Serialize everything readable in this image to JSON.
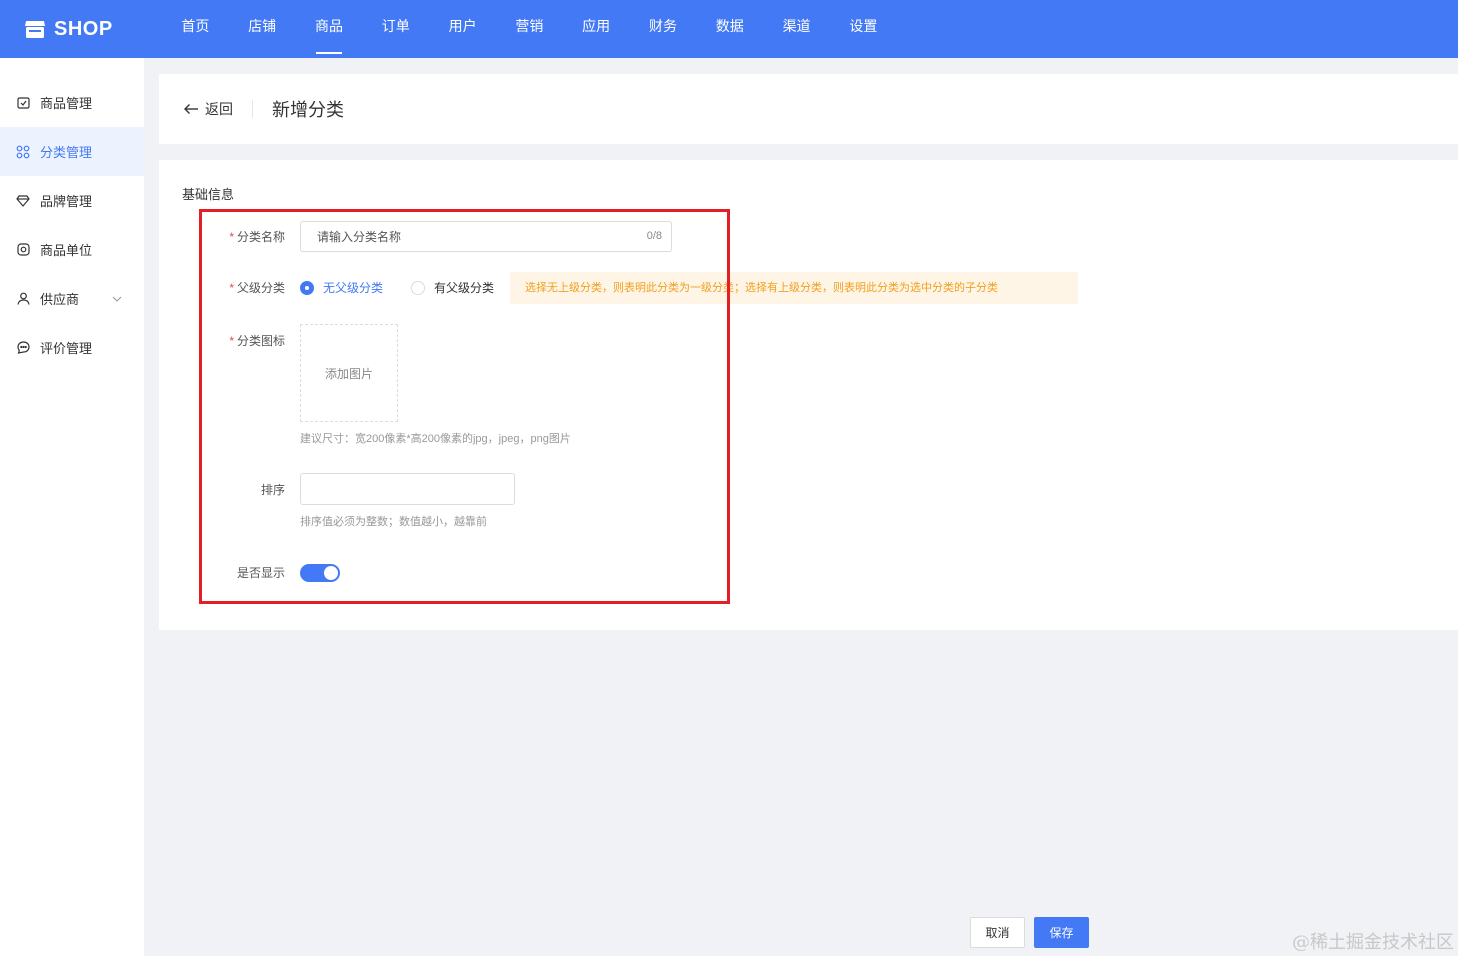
{
  "app": {
    "logo_text": "SHOP"
  },
  "nav": {
    "items": [
      "首页",
      "店铺",
      "商品",
      "订单",
      "用户",
      "营销",
      "应用",
      "财务",
      "数据",
      "渠道",
      "设置"
    ],
    "active_index": 2
  },
  "sidebar": {
    "items": [
      {
        "label": "商品管理",
        "icon": "calendar-check-icon"
      },
      {
        "label": "分类管理",
        "icon": "grid-icon",
        "active": true
      },
      {
        "label": "品牌管理",
        "icon": "diamond-icon"
      },
      {
        "label": "商品单位",
        "icon": "target-icon"
      },
      {
        "label": "供应商",
        "icon": "user-icon",
        "has_chevron": true
      },
      {
        "label": "评价管理",
        "icon": "chat-icon"
      }
    ]
  },
  "header": {
    "back_label": "返回",
    "title": "新增分类"
  },
  "form": {
    "section_title": "基础信息",
    "name_label": "分类名称",
    "name_placeholder": "请输入分类名称",
    "name_counter": "0/8",
    "parent_label": "父级分类",
    "parent_options": [
      "无父级分类",
      "有父级分类"
    ],
    "parent_selected": "无父级分类",
    "parent_tip": "选择无上级分类，则表明此分类为一级分类；选择有上级分类，则表明此分类为选中分类的子分类",
    "icon_label": "分类图标",
    "upload_label": "添加图片",
    "icon_hint": "建议尺寸：宽200像素*高200像素的jpg，jpeg，png图片",
    "sort_label": "排序",
    "sort_value": "",
    "sort_hint": "排序值必须为整数；数值越小，越靠前",
    "display_label": "是否显示",
    "display_on": true
  },
  "footer": {
    "cancel_label": "取消",
    "save_label": "保存"
  },
  "watermark": "@稀土掘金技术社区",
  "colors": {
    "primary": "#4379f5",
    "highlight_border": "#e31e24",
    "tip_bg": "#fff5e6",
    "tip_text": "#f0a020"
  }
}
